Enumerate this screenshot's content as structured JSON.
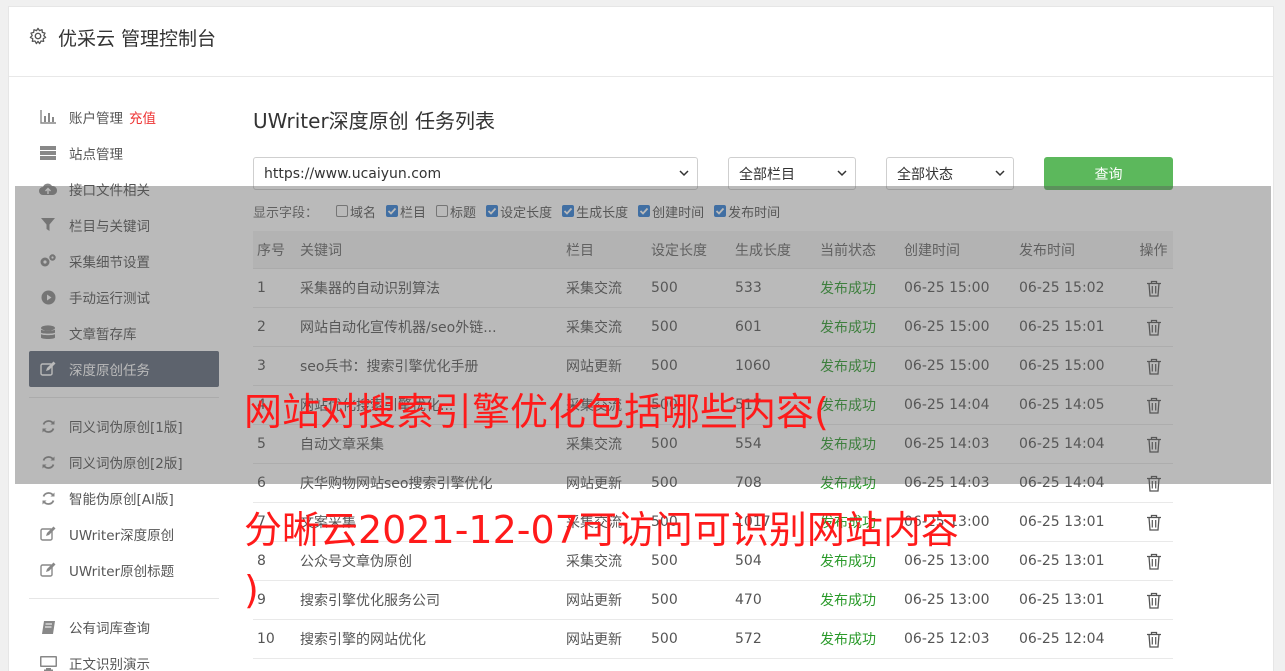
{
  "app": {
    "title": "优采云 管理控制台"
  },
  "sidebar": {
    "groups": [
      [
        {
          "label": "账户管理",
          "badge": "充值",
          "icon": "bar-chart-icon"
        },
        {
          "label": "站点管理",
          "icon": "server-icon"
        },
        {
          "label": "接口文件相关",
          "icon": "cloud-upload-icon"
        },
        {
          "label": "栏目与关键词",
          "icon": "filter-icon"
        },
        {
          "label": "采集细节设置",
          "icon": "gears-icon"
        },
        {
          "label": "手动运行测试",
          "icon": "play-icon"
        },
        {
          "label": "文章暂存库",
          "icon": "database-icon"
        },
        {
          "label": "深度原创任务",
          "icon": "edit-icon",
          "active": true
        }
      ],
      [
        {
          "label": "同义词伪原创[1版]",
          "icon": "refresh-icon"
        },
        {
          "label": "同义词伪原创[2版]",
          "icon": "refresh-icon"
        },
        {
          "label": "智能伪原创[AI版]",
          "icon": "refresh-icon"
        },
        {
          "label": "UWriter深度原创",
          "icon": "edit-icon"
        },
        {
          "label": "UWriter原创标题",
          "icon": "edit-icon"
        }
      ],
      [
        {
          "label": "公有词库查询",
          "icon": "book-icon"
        },
        {
          "label": "正文识别演示",
          "icon": "monitor-icon"
        }
      ]
    ]
  },
  "main": {
    "title": "UWriter深度原创 任务列表",
    "site_select": "https://www.ucaiyun.com",
    "column_select": "全部栏目",
    "status_select": "全部状态",
    "query_label": "查询",
    "fields_label": "显示字段：",
    "fields": [
      {
        "label": "域名",
        "checked": false
      },
      {
        "label": "栏目",
        "checked": true
      },
      {
        "label": "标题",
        "checked": false
      },
      {
        "label": "设定长度",
        "checked": true
      },
      {
        "label": "生成长度",
        "checked": true
      },
      {
        "label": "创建时间",
        "checked": true
      },
      {
        "label": "发布时间",
        "checked": true
      }
    ],
    "columns": [
      "序号",
      "关键词",
      "栏目",
      "设定长度",
      "生成长度",
      "当前状态",
      "创建时间",
      "发布时间",
      "操作"
    ],
    "rows": [
      {
        "no": "1",
        "keyword": "采集器的自动识别算法",
        "column": "采集交流",
        "set_len": "500",
        "gen_len": "533",
        "status": "发布成功",
        "created": "06-25 15:00",
        "published": "06-25 15:02"
      },
      {
        "no": "2",
        "keyword": "网站自动化宣传机器/seo外链...",
        "column": "采集交流",
        "set_len": "500",
        "gen_len": "601",
        "status": "发布成功",
        "created": "06-25 15:00",
        "published": "06-25 15:01"
      },
      {
        "no": "3",
        "keyword": "seo兵书：搜索引擎优化手册",
        "column": "网站更新",
        "set_len": "500",
        "gen_len": "1060",
        "status": "发布成功",
        "created": "06-25 15:00",
        "published": "06-25 15:00"
      },
      {
        "no": "4",
        "keyword": "网站优化搜索引擎优化...",
        "column": "采集交流",
        "set_len": "500",
        "gen_len": "517",
        "status": "发布成功",
        "created": "06-25 14:04",
        "published": "06-25 14:05"
      },
      {
        "no": "5",
        "keyword": "自动文章采集",
        "column": "采集交流",
        "set_len": "500",
        "gen_len": "554",
        "status": "发布成功",
        "created": "06-25 14:03",
        "published": "06-25 14:04"
      },
      {
        "no": "6",
        "keyword": "庆华购物网站seo搜索引擎优化",
        "column": "网站更新",
        "set_len": "500",
        "gen_len": "708",
        "status": "发布成功",
        "created": "06-25 14:03",
        "published": "06-25 14:04"
      },
      {
        "no": "7",
        "keyword": "文案采集",
        "column": "采集交流",
        "set_len": "500",
        "gen_len": "1017",
        "status": "发布成功",
        "created": "06-25 13:00",
        "published": "06-25 13:01"
      },
      {
        "no": "8",
        "keyword": "公众号文章伪原创",
        "column": "采集交流",
        "set_len": "500",
        "gen_len": "504",
        "status": "发布成功",
        "created": "06-25 13:00",
        "published": "06-25 13:01"
      },
      {
        "no": "9",
        "keyword": "搜索引擎优化服务公司",
        "column": "网站更新",
        "set_len": "500",
        "gen_len": "470",
        "status": "发布成功",
        "created": "06-25 13:00",
        "published": "06-25 13:01"
      },
      {
        "no": "10",
        "keyword": "搜索引擎的网站优化",
        "column": "网站更新",
        "set_len": "500",
        "gen_len": "572",
        "status": "发布成功",
        "created": "06-25 12:03",
        "published": "06-25 12:04"
      }
    ]
  },
  "watermark": {
    "line1": "网站对搜索引擎优化包括哪些内容(",
    "line2": "分晰云2021-12-07可访问可识别网站内容",
    "line3": ")"
  }
}
